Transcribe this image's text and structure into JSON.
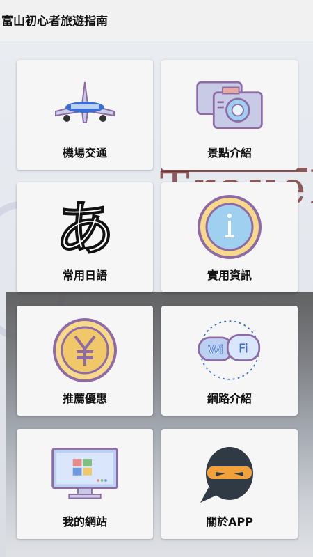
{
  "app": {
    "title": "富山初心者旅遊指南"
  },
  "background": {
    "deco_text": "Travel"
  },
  "menu": [
    {
      "label": "機場交通",
      "icon": "airplane-icon"
    },
    {
      "label": "景點介紹",
      "icon": "camera-icon"
    },
    {
      "label": "常用日語",
      "icon": "hiragana-a-icon"
    },
    {
      "label": "實用資訊",
      "icon": "info-icon"
    },
    {
      "label": "推薦優惠",
      "icon": "yen-coin-icon"
    },
    {
      "label": "網路介紹",
      "icon": "wifi-icon"
    },
    {
      "label": "我的網站",
      "icon": "computer-monitor-icon"
    },
    {
      "label": "關於APP",
      "icon": "ninja-icon"
    }
  ],
  "colors": {
    "card": "#f6f6f6",
    "appbar": "#f1f1f1",
    "accent_purple": "#8e6aa6",
    "accent_blue": "#3a6fd0"
  }
}
